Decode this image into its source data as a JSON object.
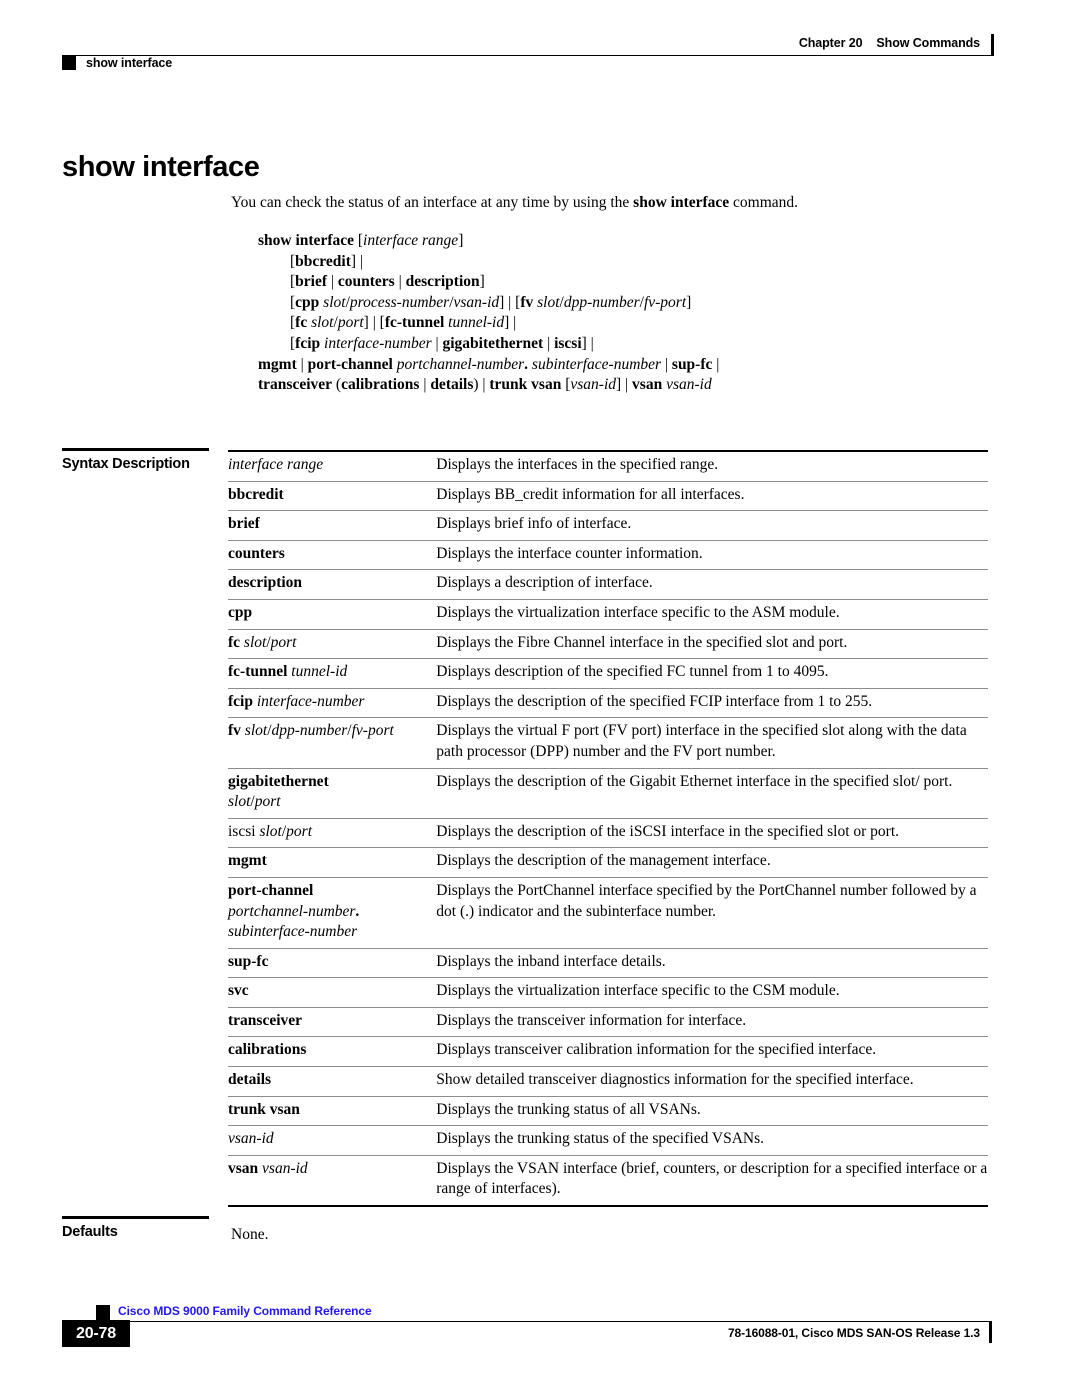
{
  "header": {
    "chapter": "Chapter 20",
    "section": "Show Commands",
    "running_topic": "show interface"
  },
  "title": "show interface",
  "intro": {
    "before": "You can check the status of an interface at any time by using the ",
    "command": "show interface",
    "after": " command."
  },
  "syntax": {
    "lines": [
      "show interface [interface range]",
      "[bbcredit] |",
      "[brief | counters | description]",
      "[cpp slot/process-number/vsan-id] | [fv slot/dpp-number/fv-port]",
      "[fc slot/port] | [fc-tunnel tunnel-id] |",
      "[fcip interface-number | gigabitethernet | iscsi] |",
      "mgmt | port-channel portchannel-number. subinterface-number | sup-fc |",
      "transceiver (calibrations | details) | trunk vsan [vsan-id] | vsan vsan-id"
    ]
  },
  "sections": {
    "syntax_description_label": "Syntax Description",
    "defaults_label": "Defaults",
    "defaults_value": "None."
  },
  "syntax_table": {
    "rows": [
      {
        "term": "interface range",
        "desc": "Displays the interfaces in the specified range."
      },
      {
        "term": "bbcredit",
        "desc": "Displays BB_credit information for all interfaces."
      },
      {
        "term": "brief",
        "desc": "Displays brief info of interface."
      },
      {
        "term": "counters",
        "desc": "Displays the interface counter information."
      },
      {
        "term": "description",
        "desc": "Displays a description of interface."
      },
      {
        "term": "cpp",
        "desc": "Displays the virtualization interface specific to the ASM module."
      },
      {
        "term": "fc slot/port",
        "desc": "Displays the Fibre Channel interface in the specified slot and port."
      },
      {
        "term": "fc-tunnel tunnel-id",
        "desc": "Displays description of the specified FC tunnel from 1 to 4095."
      },
      {
        "term": "fcip interface-number",
        "desc": "Displays the description of the specified FCIP interface from 1 to 255."
      },
      {
        "term": "fv slot/dpp-number/fv-port",
        "desc": "Displays the virtual F port (FV port) interface in the specified slot along with the data path processor (DPP) number and the FV port number."
      },
      {
        "term": "gigabitethernet slot/port",
        "desc": "Displays the description of the Gigabit Ethernet interface in the specified slot/ port."
      },
      {
        "term": "iscsi slot/port",
        "desc": "Displays the description of the iSCSI interface in the specified slot or port."
      },
      {
        "term": "mgmt",
        "desc": "Displays the description of the management interface."
      },
      {
        "term": "port-channel portchannel-number. subinterface-number",
        "desc": "Displays the PortChannel interface specified by the PortChannel number followed by a dot (.) indicator and the subinterface number."
      },
      {
        "term": "sup-fc",
        "desc": "Displays the inband interface details."
      },
      {
        "term": "svc",
        "desc": "Displays the virtualization interface specific to the CSM module."
      },
      {
        "term": "transceiver",
        "desc": "Displays the transceiver information for interface."
      },
      {
        "term": "calibrations",
        "desc": "Displays transceiver calibration information for the specified interface."
      },
      {
        "term": "details",
        "desc": "Show detailed transceiver diagnostics information for the specified interface."
      },
      {
        "term": "trunk vsan",
        "desc": "Displays the trunking status of all VSANs."
      },
      {
        "term": "vsan-id",
        "desc": "Displays the trunking status of the specified VSANs."
      },
      {
        "term": "vsan vsan-id",
        "desc": "Displays the VSAN interface (brief, counters, or description for a specified interface or a range of interfaces)."
      }
    ]
  },
  "footer": {
    "book_title": "Cisco MDS 9000 Family Command Reference",
    "page_number": "20-78",
    "doc_id": "78-16088-01, Cisco MDS SAN-OS Release 1.3"
  },
  "colors": {
    "book_title_blue": "#2417f0",
    "rule_gray": "#8c8c8c",
    "text_black": "#000000"
  }
}
